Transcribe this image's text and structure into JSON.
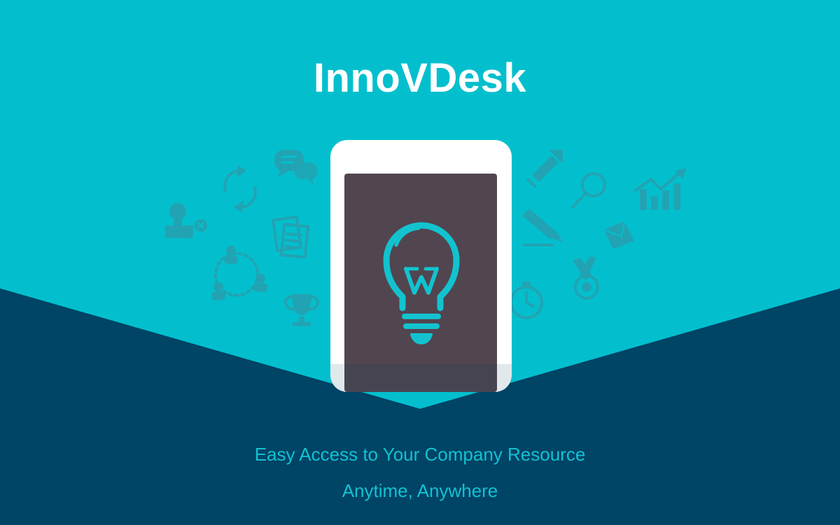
{
  "app": {
    "title": "InnoVDesk"
  },
  "tagline": {
    "line1": "Easy Access to Your Company Resource",
    "line2": "Anytime, Anywhere"
  },
  "colors": {
    "background_teal": "#03bfcd",
    "navy": "#004466",
    "phone_screen": "#514550",
    "bulb": "#12c3cf",
    "decor_icons": "#22a3b3",
    "tagline_text": "#13c1d0"
  },
  "icons": [
    "chat-bubbles-icon",
    "refresh-arrows-icon",
    "stamp-icon",
    "document-icon",
    "people-network-icon",
    "trophy-icon",
    "pencil-arrow-icon",
    "search-icon",
    "growth-chart-icon",
    "pen-icon",
    "envelope-icon",
    "stopwatch-icon",
    "medal-icon",
    "lightbulb-icon"
  ]
}
